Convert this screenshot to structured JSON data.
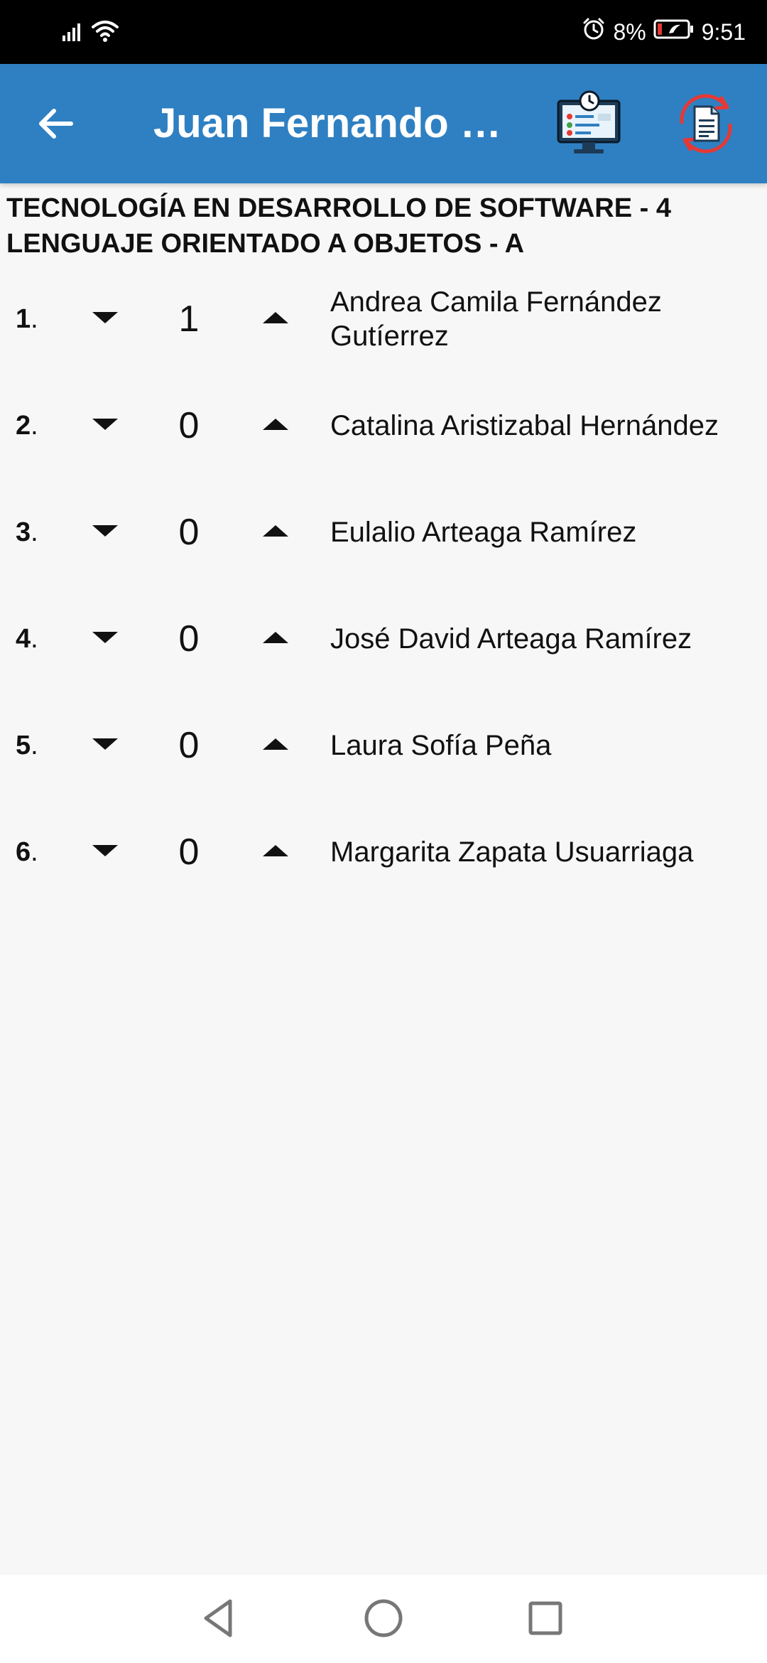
{
  "status_bar": {
    "battery_percent": "8%",
    "time": "9:51",
    "icons": [
      "signal-icon",
      "wifi-icon",
      "alarm-icon",
      "battery-icon"
    ]
  },
  "app_bar": {
    "title": "Juan Fernando S...",
    "icons": [
      "back-arrow-icon",
      "attendance-monitor-icon",
      "document-sync-icon"
    ],
    "background_color": "#2f80c2"
  },
  "course": {
    "program": "TECNOLOGÍA EN DESARROLLO DE SOFTWARE - 4",
    "subject": "LENGUAJE ORIENTADO A OBJETOS - A"
  },
  "students": [
    {
      "number": "1",
      "score": "1",
      "name": "Andrea Camila Fernández Gutíerrez"
    },
    {
      "number": "2",
      "score": "0",
      "name": "Catalina Aristizabal Hernández"
    },
    {
      "number": "3",
      "score": "0",
      "name": "Eulalio Arteaga Ramírez"
    },
    {
      "number": "4",
      "score": "0",
      "name": "José David Arteaga Ramírez"
    },
    {
      "number": "5",
      "score": "0",
      "name": "Laura Sofía Peña"
    },
    {
      "number": "6",
      "score": "0",
      "name": "Margarita Zapata Usuarriaga"
    }
  ],
  "nav_bar": {
    "icons": [
      "back-triangle-icon",
      "home-circle-icon",
      "recents-square-icon"
    ]
  }
}
